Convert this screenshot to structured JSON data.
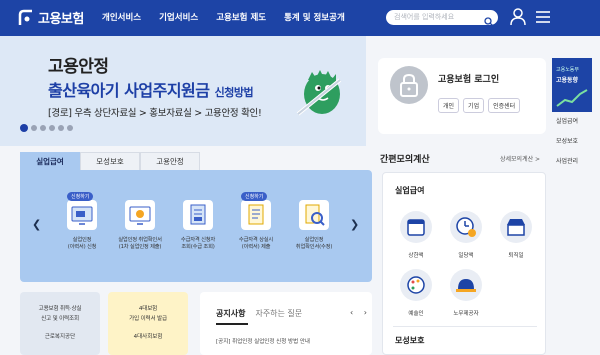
{
  "header": {
    "logo_text": "고용보험",
    "nav": [
      "개인서비스",
      "기업서비스",
      "고용보험 제도",
      "통계 및 정보공개"
    ],
    "search_placeholder": "검색어를 입력하세요"
  },
  "banner": {
    "title": "고용안정",
    "headline": "출산육아기 사업주지원금",
    "headline_suffix": "신청방법",
    "path": "[경로] 우측 상단자료실 > 홍보자료실 > 고용안정 확인!",
    "slide_count": 6,
    "active_slide": 1
  },
  "login": {
    "title": "고용보험 로그인",
    "buttons": [
      "개인",
      "기업",
      "인증센터"
    ]
  },
  "side_promo": {
    "line1": "고용노동부",
    "line2": "고용동향"
  },
  "side_links": [
    "실업급여",
    "모성보호",
    "사업관리"
  ],
  "services": {
    "tabs": [
      "실업급여",
      "모성보호",
      "고용안정"
    ],
    "active_tab": 0,
    "items": [
      {
        "badge": "신청하기",
        "label": "실업인정\n(이력서) 신청"
      },
      {
        "badge": "",
        "label": "실업인정 취업확인서\n(1차 실업인정 제출)"
      },
      {
        "badge": "",
        "label": "수급자격 신청자\n조회(수급 조회)"
      },
      {
        "badge": "신청하기",
        "label": "수급자격 상실시\n(이력서) 제출"
      },
      {
        "badge": "",
        "label": "실업인정\n취업확인서(수정)"
      }
    ]
  },
  "calculator": {
    "title": "간편모의계산",
    "more": "상세모의계산 >",
    "section1": "실업급여",
    "items": [
      "상한액",
      "일당액",
      "퇴직일",
      "예술인",
      "노무제공자"
    ],
    "section2": "모성보호"
  },
  "quick": [
    {
      "text": "고용보험 취득·상실\n신고 및 이력조회",
      "org": "근로복지공단"
    },
    {
      "text": "4대보험\n가입 이력서 발급",
      "org": "4대사회보험"
    }
  ],
  "notice": {
    "tabs": [
      "공지사항",
      "자주하는 질문"
    ],
    "arrows": "‹ ›",
    "first_item": "[공지] 취업인정 실업인정 신청 방법 안내"
  },
  "colors": {
    "primary": "#1d44a6",
    "panel": "#a9c9f0",
    "banner_bg": "#dde8f6",
    "accent_green": "#2e9e5f"
  }
}
